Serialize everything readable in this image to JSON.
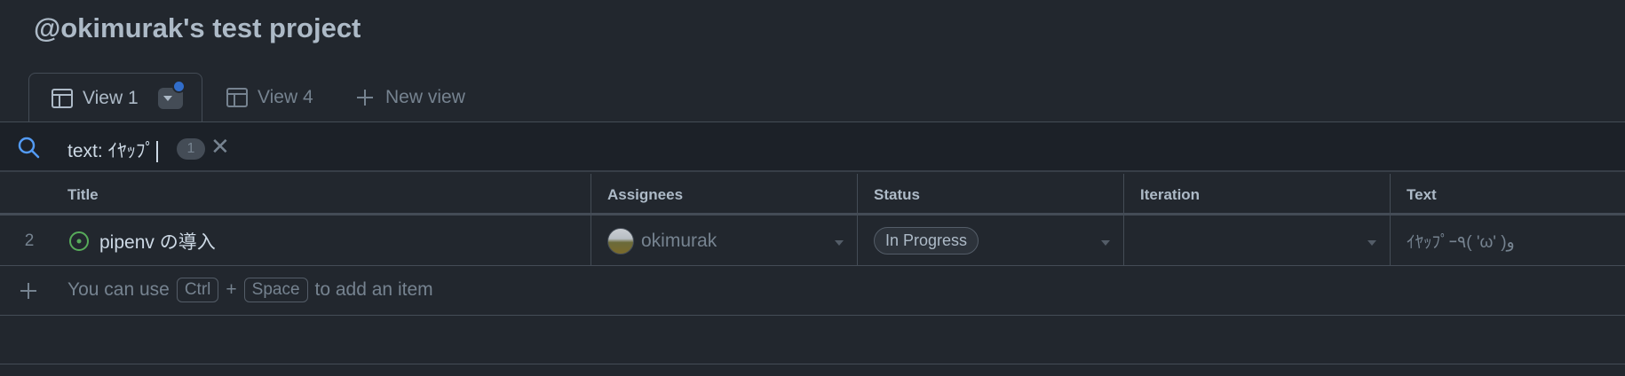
{
  "project": {
    "title": "@okimurak's test project"
  },
  "tabs": [
    {
      "label": "View 1",
      "active": true
    },
    {
      "label": "View 4",
      "active": false
    },
    {
      "label": "New view",
      "active": false
    }
  ],
  "filter": {
    "query": "text: ｲﾔｯﾌﾟ",
    "match_count": "1"
  },
  "table": {
    "columns": [
      "Title",
      "Assignees",
      "Status",
      "Iteration",
      "Text"
    ],
    "rows": [
      {
        "number": "2",
        "title": "pipenv の導入",
        "assignee": "okimurak",
        "status": "In Progress",
        "iteration": "",
        "text": "ｲﾔｯﾌﾟｰ٩( 'ω' )و"
      }
    ]
  },
  "add_item": {
    "prefix": "You can use",
    "key1": "Ctrl",
    "plus": "+",
    "key2": "Space",
    "suffix": "to add an item"
  },
  "icons": {
    "search": "search-icon",
    "table_view": "table-icon",
    "plus": "plus-icon",
    "issue_open": "issue-opened-icon",
    "close": "x-icon"
  },
  "colors": {
    "background": "#22272e",
    "accent": "#316dca",
    "open_issue": "#57ab5a"
  }
}
